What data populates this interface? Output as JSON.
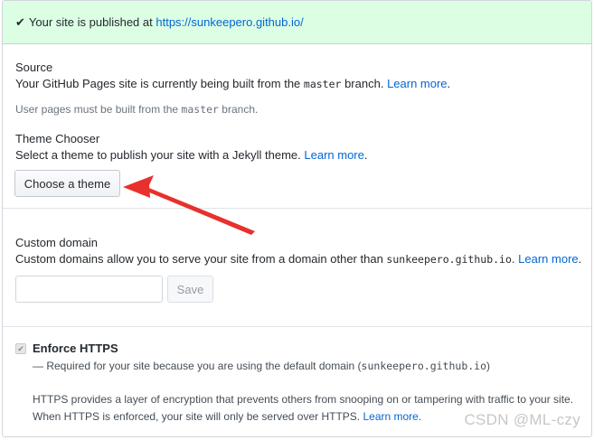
{
  "flash": {
    "check_icon": "check-icon",
    "text": "Your site is published at ",
    "url": "https://sunkeepero.github.io/"
  },
  "source": {
    "heading": "Source",
    "desc_prefix": "Your GitHub Pages site is currently being built from the ",
    "branch": "master",
    "desc_suffix": " branch.",
    "learn_more": "Learn more",
    "note_prefix": "User pages must be built from the ",
    "note_branch": "master",
    "note_suffix": " branch."
  },
  "theme": {
    "heading": "Theme Chooser",
    "desc": "Select a theme to publish your site with a Jekyll theme.",
    "learn_more": "Learn more",
    "button": "Choose a theme"
  },
  "custom_domain": {
    "heading": "Custom domain",
    "desc_prefix": "Custom domains allow you to serve your site from a domain other than ",
    "domain": "sunkeepero.github.io",
    "desc_suffix": ".",
    "learn_more": "Learn more",
    "input_value": "",
    "save_label": "Save"
  },
  "https": {
    "label": "Enforce HTTPS",
    "checked": true,
    "note_prefix": "— Required for your site because you are using the default domain (",
    "note_domain": "sunkeepero.github.io",
    "note_suffix": ")",
    "para1": "HTTPS provides a layer of encryption that prevents others from snooping on or tampering with traffic to your site.",
    "para2": "When HTTPS is enforced, your site will only be served over HTTPS.",
    "learn_more": "Learn more"
  },
  "watermark": "CSDN @ML-czy",
  "colors": {
    "flash_bg": "#dcffe4",
    "link": "#0366d6",
    "arrow": "#e8302d"
  }
}
